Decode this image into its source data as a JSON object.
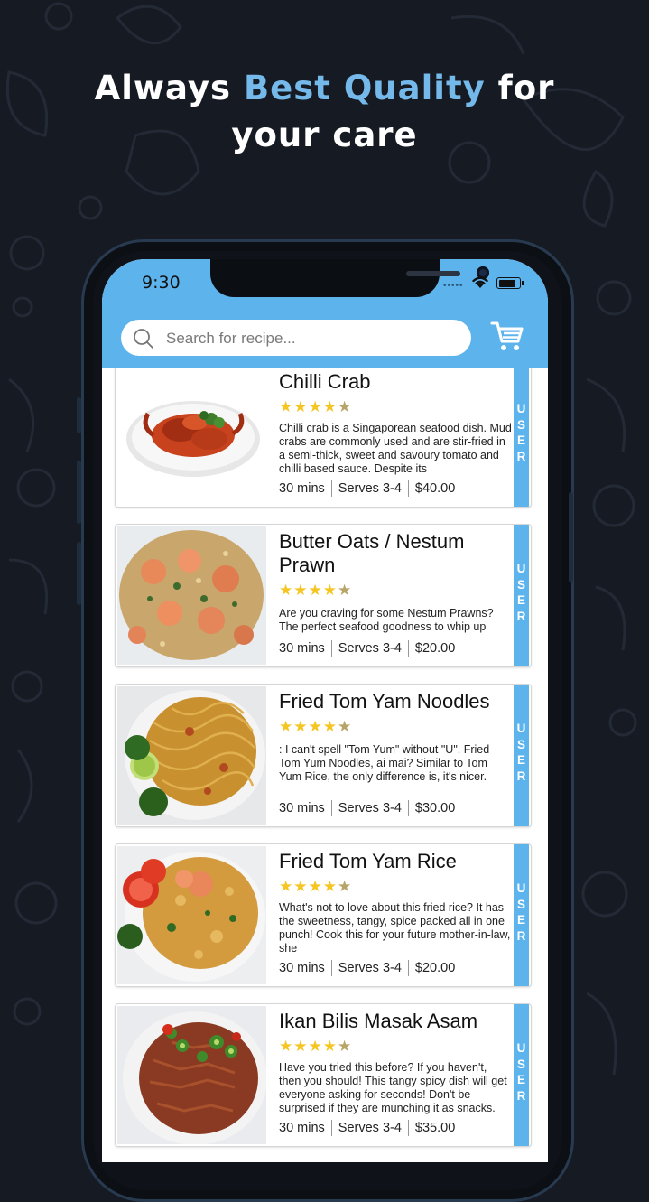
{
  "headline": {
    "line1_prefix": "Always",
    "line1_accent": "Best Quality",
    "line1_suffix": "for",
    "line2": "your care"
  },
  "colors": {
    "background": "#161a22",
    "accent": "#74b9ea",
    "app_bar": "#5db3ec",
    "star": "#f5c521"
  },
  "status_bar": {
    "time": "9:30",
    "signal": "•••••",
    "icons": [
      "wifi-icon",
      "battery-icon"
    ]
  },
  "search": {
    "placeholder": "Search for recipe...",
    "value": "",
    "cart_icon": "cart-icon"
  },
  "recipes": [
    {
      "title": "Chilli Crab",
      "rating": 4.5,
      "stars": "★★★★",
      "half_star": "★",
      "description": "Chilli crab is a Singaporean seafood dish. Mud crabs are commonly used and are stir-fried in a semi-thick, sweet and savoury tomato and chilli based sauce. Despite its",
      "time": "30 mins",
      "serves": "Serves 3-4",
      "price": "$40.00",
      "tab_label": "USER"
    },
    {
      "title": "Butter Oats / Nestum Prawn",
      "rating": 4.5,
      "stars": "★★★★",
      "half_star": "★",
      "description": "Are you craving for some Nestum Prawns? The perfect seafood goodness to whip up",
      "time": "30 mins",
      "serves": "Serves 3-4",
      "price": "$20.00",
      "tab_label": "USER"
    },
    {
      "title": "Fried Tom Yam Noodles",
      "rating": 4.5,
      "stars": "★★★★",
      "half_star": "★",
      "description": ": I can't spell \"Tom Yum\" without \"U\". Fried Tom Yum Noodles, ai mai? Similar to Tom Yum Rice, the only difference is, it's nicer.",
      "time": "30 mins",
      "serves": "Serves 3-4",
      "price": "$30.00",
      "tab_label": "USER"
    },
    {
      "title": "Fried Tom Yam Rice",
      "rating": 4.5,
      "stars": "★★★★",
      "half_star": "★",
      "description": "What's not to love about this fried rice? It has the sweetness, tangy, spice packed all in one punch! Cook this for your future mother-in-law, she",
      "time": "30 mins",
      "serves": "Serves 3-4",
      "price": "$20.00",
      "tab_label": "USER"
    },
    {
      "title": "Ikan Bilis Masak Asam",
      "rating": 4.5,
      "stars": "★★★★",
      "half_star": "★",
      "description": "Have you tried this before? If you haven't, then you should! This tangy spicy dish will get everyone asking for seconds! Don't be surprised if they are munching it as snacks.",
      "time": "30 mins",
      "serves": "Serves 3-4",
      "price": "$35.00",
      "tab_label": "USER"
    }
  ]
}
